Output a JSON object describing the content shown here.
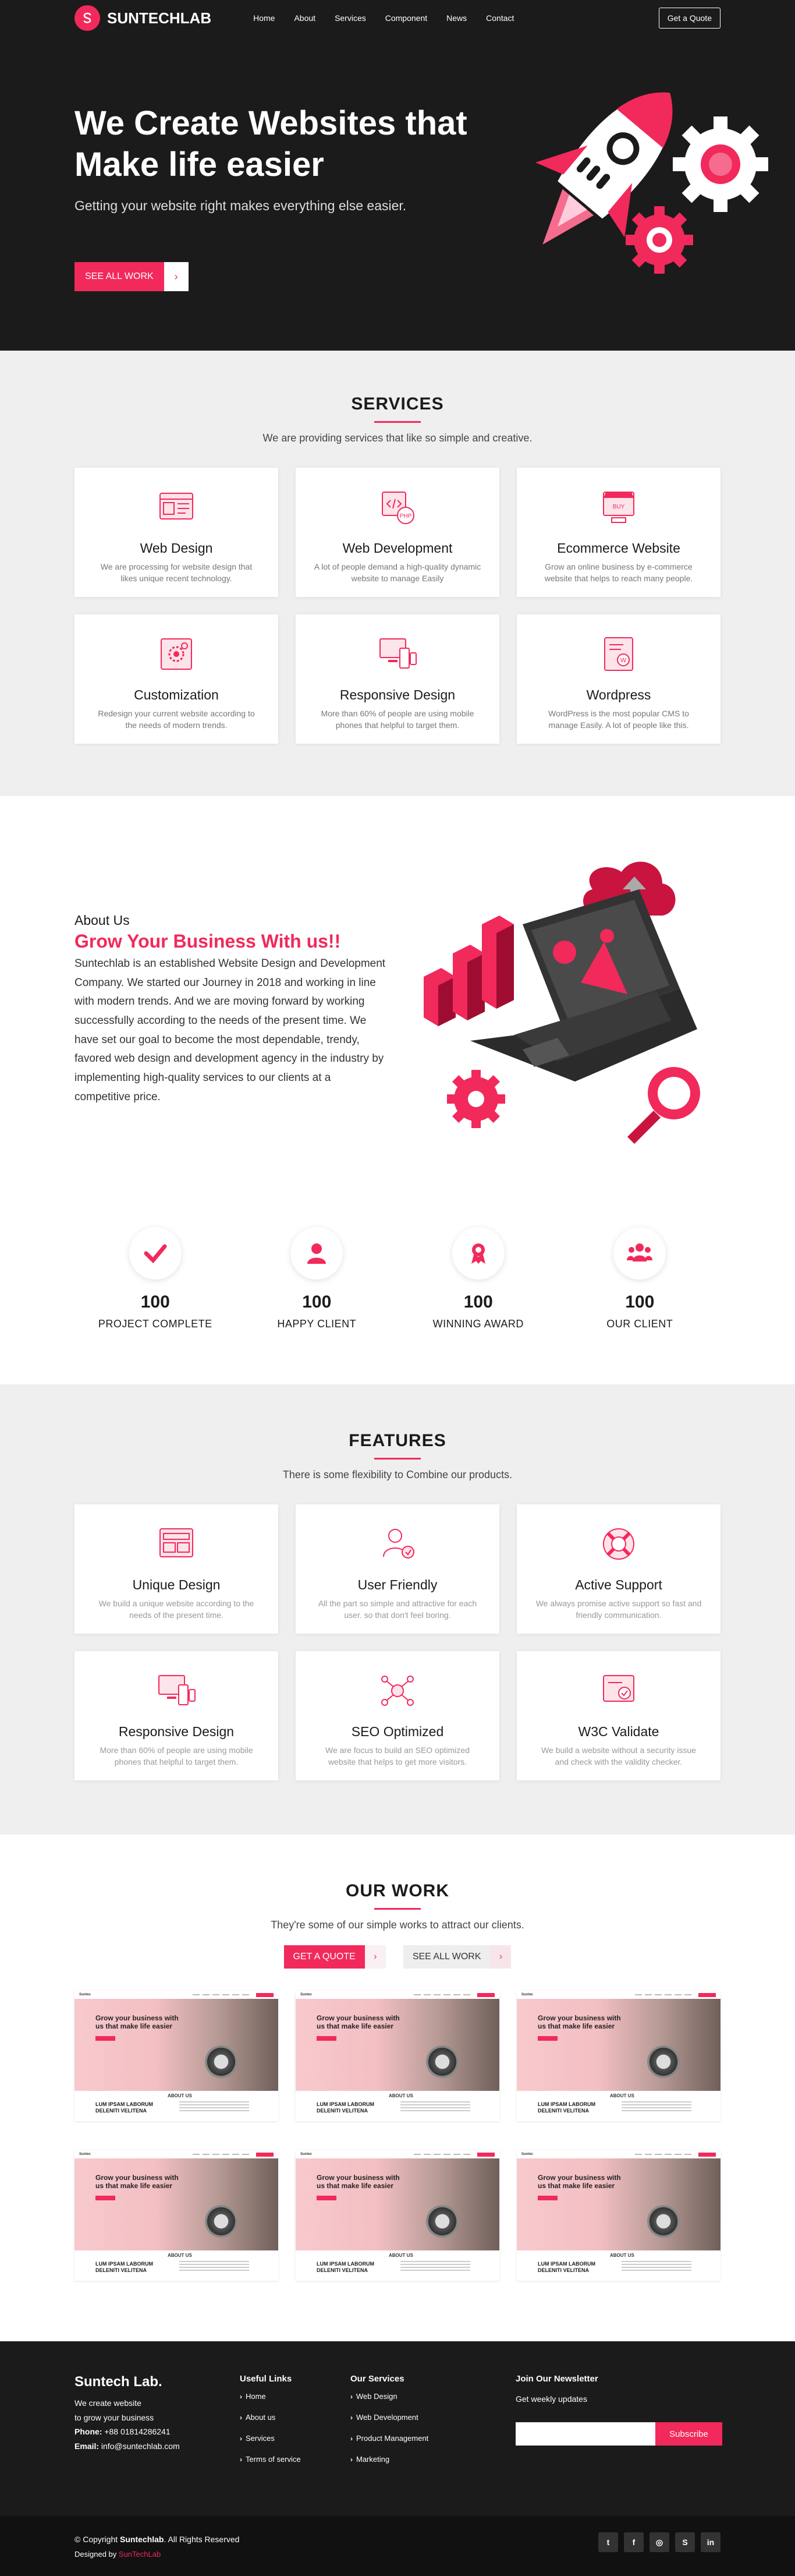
{
  "nav": {
    "brand": "SUNTECHLAB",
    "links": [
      "Home",
      "About",
      "Services",
      "Component",
      "News",
      "Contact"
    ],
    "quote_btn": "Get a Quote"
  },
  "hero": {
    "title": "We Create Websites that Make life easier",
    "subtitle": "Getting your website right makes everything else easier.",
    "cta": "SEE ALL WORK"
  },
  "services": {
    "title": "SERVICES",
    "subtitle": "We are providing services that like so simple and creative.",
    "items": [
      {
        "title": "Web Design",
        "text": "We are processing for website design that likes unique recent technology."
      },
      {
        "title": "Web Development",
        "text": "A lot of people demand a high-quality dynamic website to manage Easily"
      },
      {
        "title": "Ecommerce Website",
        "text": "Grow an online business by e-commerce website that helps to reach many people."
      },
      {
        "title": "Customization",
        "text": "Redesign your current website according to the needs of modern trends."
      },
      {
        "title": "Responsive Design",
        "text": "More than 60% of people are using mobile phones that helpful to target them."
      },
      {
        "title": "Wordpress",
        "text": "WordPress is the most popular CMS to manage Easily. A lot of people like this."
      }
    ]
  },
  "about": {
    "label": "About Us",
    "heading": "Grow Your Business With us!!",
    "text": "Suntechlab is an established Website Design and Development Company. We started our Journey in 2018 and working in line with modern trends. And we are moving forward by working successfully according to the needs of the present time. We have set our goal to become the most dependable, trendy, favored web design and development agency in the industry by implementing high-quality services to our clients at a competitive price."
  },
  "stats": [
    {
      "value": "100",
      "label": "PROJECT COMPLETE",
      "icon": "checkmark-icon"
    },
    {
      "value": "100",
      "label": "HAPPY CLIENT",
      "icon": "user-icon"
    },
    {
      "value": "100",
      "label": "WINNING AWARD",
      "icon": "award-icon"
    },
    {
      "value": "100",
      "label": "OUR CLIENT",
      "icon": "users-icon"
    }
  ],
  "features": {
    "title": "FEATURES",
    "subtitle": "There is some flexibility to Combine our products.",
    "items": [
      {
        "title": "Unique Design",
        "text": "We build a unique website according to the needs of the present time."
      },
      {
        "title": "User Friendly",
        "text": "All the part so simple and attractive for each user. so that don't feel boring."
      },
      {
        "title": "Active Support",
        "text": "We always promise active support so fast and friendly communication."
      },
      {
        "title": "Responsive Design",
        "text": "More than 60% of people are using mobile phones that helpful to target them."
      },
      {
        "title": "SEO Optimized",
        "text": "We are focus to build an SEO optimized website that helps to get more visitors."
      },
      {
        "title": "W3C Validate",
        "text": "We build a website without a security issue and check with the validity checker."
      }
    ]
  },
  "work": {
    "title": "OUR WORK",
    "subtitle": "They're some of our simple works to attract our clients.",
    "btn_quote": "GET A QUOTE",
    "btn_all": "SEE ALL WORK",
    "thumb": {
      "logo": "Suntec",
      "headline": "Grow your business with us that make life easier",
      "about": "ABOUT US",
      "title": "LUM IPSAM LABORUM DELENITI VELITENA"
    }
  },
  "footer": {
    "brand": "Suntech Lab.",
    "tagline": "We create website",
    "tagline2": "to grow your business",
    "phone_label": "Phone:",
    "phone": "+88 01814286241",
    "email_label": "Email:",
    "email": "info@suntechlab.com",
    "useful_title": "Useful Links",
    "useful_links": [
      "Home",
      "About us",
      "Services",
      "Terms of service"
    ],
    "services_title": "Our Services",
    "services_links": [
      "Web Design",
      "Web Development",
      "Product Management",
      "Marketing"
    ],
    "newsletter_title": "Join Our Newsletter",
    "newsletter_text": "Get weekly updates",
    "subscribe": "Subscribe",
    "copyright_pre": "© Copyright",
    "copyright_brand": "Suntechlab",
    "copyright_post": ". All Rights Reserved",
    "designed_by": "Designed by",
    "designer": "SunTechLab"
  },
  "colors": {
    "accent": "#f2295b",
    "dark": "#1b1b1b",
    "light_bg": "#efefef"
  }
}
